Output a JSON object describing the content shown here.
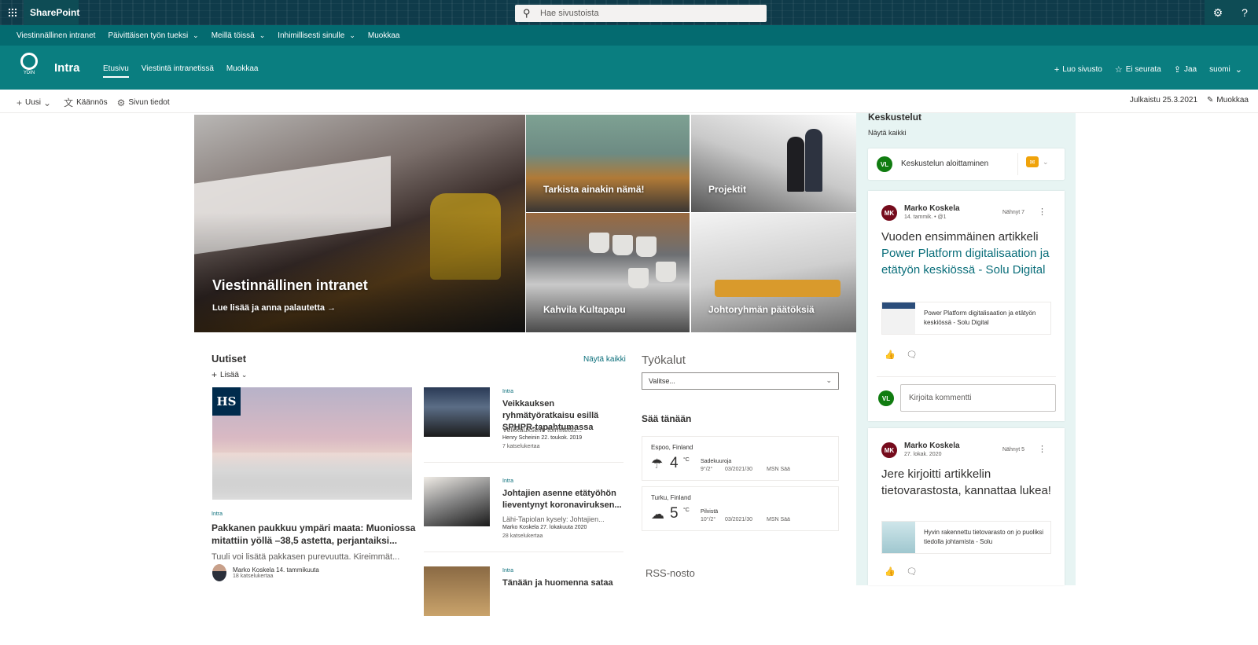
{
  "suite": {
    "app_name": "SharePoint",
    "search_placeholder": "Hae sivustoista",
    "search_icon": "search-icon",
    "settings_icon": "gear-icon",
    "help_label": "?"
  },
  "hub_nav": [
    {
      "label": "Viestinnällinen intranet",
      "has_menu": false
    },
    {
      "label": "Päivittäisen työn tueksi",
      "has_menu": true
    },
    {
      "label": "Meillä töissä",
      "has_menu": true
    },
    {
      "label": "Inhimillisesti sinulle",
      "has_menu": true
    },
    {
      "label": "Muokkaa",
      "has_menu": false
    }
  ],
  "site": {
    "logo_text": "YDIN",
    "title": "Intra",
    "nav": [
      {
        "label": "Etusivu",
        "active": true
      },
      {
        "label": "Viestintä intranetissä",
        "active": false
      },
      {
        "label": "Muokkaa",
        "active": false
      }
    ],
    "actions": {
      "create": "Luo sivusto",
      "follow": "Ei seurata",
      "share": "Jaa",
      "language": "suomi"
    }
  },
  "command_bar": {
    "new": "Uusi",
    "translate": "Käännös",
    "page_details": "Sivun tiedot",
    "published": "Julkaistu 25.3.2021",
    "edit": "Muokkaa"
  },
  "hero": {
    "main_title": "Viestinnällinen intranet",
    "main_link": "Lue lisää ja anna palautetta →",
    "tile1": "Tarkista ainakin nämä!",
    "tile2": "Projektit",
    "tile3": "Kahvila Kultapapu",
    "tile4": "Johtoryhmän päätöksiä"
  },
  "news": {
    "title": "Uutiset",
    "see_all": "Näytä kaikki",
    "add": "Lisää",
    "main": {
      "badge": "HS",
      "tag": "Intra",
      "headline": "Pakkanen paukkuu ympäri maata: Muoniossa mitattiin yöllä –38,5 astetta, perjantaiksi...",
      "desc": "Tuuli voi lisätä pakkasen purevuutta. Kireimmät...",
      "author": "Marko Koskela 14. tammikuuta",
      "views": "18 katselukertaa"
    },
    "items": [
      {
        "tag": "Intra",
        "headline": "Veikkauksen ryhmätyöratkaisu esillä SPHPR-tapahtumassa",
        "desc": "Veikkaukselle toimitettu...",
        "author": "Henry Scheinin 22. toukok. 2019",
        "views": "7 katselukertaa"
      },
      {
        "tag": "Intra",
        "headline": "Johtajien asenne etätyöhön lieventynyt koronaviruksen...",
        "desc": "Lähi-Tapiolan kysely: Johtajien...",
        "author": "Marko Koskela 27. lokakuuta 2020",
        "views": "28 katselukertaa"
      },
      {
        "tag": "Intra",
        "headline": "Tänään ja huomenna sataa",
        "desc": "",
        "author": "",
        "views": ""
      }
    ]
  },
  "tools": {
    "title": "Työkalut",
    "select_value": "Valitse..."
  },
  "weather": {
    "title": "Sää tänään",
    "cards": [
      {
        "city": "Espoo, Finland",
        "icon": "rain-cloud-icon",
        "temp": "4",
        "unit": "°C",
        "condition": "Sadekuuroja",
        "hilo": "9°/2°",
        "date": "03/2021/30",
        "source": "MSN Sää"
      },
      {
        "city": "Turku, Finland",
        "icon": "cloud-icon",
        "temp": "5",
        "unit": "°C",
        "condition": "Pilvistä",
        "hilo": "10°/2°",
        "date": "03/2021/30",
        "source": "MSN Sää"
      }
    ]
  },
  "rss": {
    "title": "RSS-nosto"
  },
  "conversations": {
    "title": "Keskustelut",
    "see_all": "Näytä kaikki",
    "start_initials": "VL",
    "start_placeholder": "Keskustelun aloittaminen",
    "posts": [
      {
        "initials": "MK",
        "author": "Marko Koskela",
        "meta": "14. tammik. • @1",
        "seen": "Nähnyt 7",
        "body_text": "Vuoden ensimmäinen artikkeli ",
        "body_link": "Power Platform digitalisaation ja etätyön keskiössä - Solu Digital",
        "card_text": "Power Platform digitalisaation ja etätyön keskiössä - Solu Digital",
        "comment_initials": "VL",
        "comment_placeholder": "Kirjoita kommentti"
      },
      {
        "initials": "MK",
        "author": "Marko Koskela",
        "meta": "27. lokak. 2020",
        "seen": "Nähnyt 5",
        "body_text": "Jere kirjoitti artikkelin tietovarastosta, kannattaa lukea!",
        "body_link": "",
        "card_text": "Hyvin rakennettu tietovarasto on jo puoliksi tiedolla johtamista - Solu",
        "comment_initials": "",
        "comment_placeholder": ""
      }
    ]
  }
}
